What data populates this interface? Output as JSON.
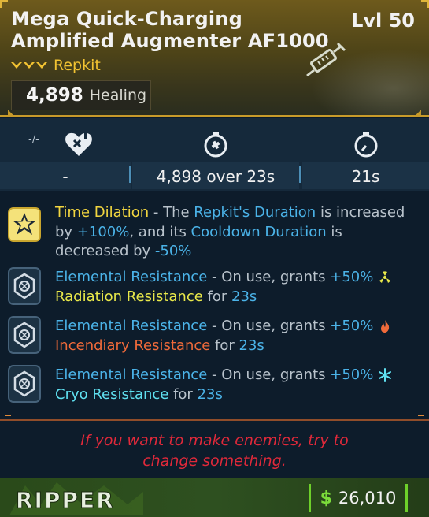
{
  "item": {
    "name": "Mega Quick-Charging Amplified Augmenter AF1000",
    "level": "Lvl 50",
    "rarity_type": "Repkit",
    "healing_value": "4,898",
    "healing_label": "Healing"
  },
  "stats": {
    "cooldown_prefix": "-/-",
    "stat1_value": "-",
    "stat2_value": "4,898 over 23s",
    "stat3_value": "21s"
  },
  "perks": [
    {
      "title": "Time Dilation",
      "sep": " - The ",
      "a": "Repkit's Duration",
      "b": " is increased by ",
      "c": "+100%",
      "d": ", and its ",
      "e": "Cooldown Duration",
      "f": " is decreased by ",
      "g": "-50%"
    },
    {
      "title": "Elemental Resistance",
      "mid": " - On use, grants ",
      "pct": "+50%",
      "element": "Radiation Resistance",
      "for": " for ",
      "dur": "23s"
    },
    {
      "title": "Elemental Resistance",
      "mid": " - On use, grants ",
      "pct": "+50%",
      "element": "Incendiary Resistance",
      "for": " for ",
      "dur": "23s"
    },
    {
      "title": "Elemental Resistance",
      "mid": " - On use, grants ",
      "pct": "+50%",
      "element": "Cryo Resistance",
      "for": " for ",
      "dur": "23s"
    }
  ],
  "flavor": {
    "line1": "If you want to make enemies, try to",
    "line2": "change something."
  },
  "footer": {
    "manufacturer": "RIPPER",
    "currency": "$",
    "price": "26,010"
  },
  "colors": {
    "rarity": "#f1c232",
    "highlight_blue": "#4bb3e8",
    "flavor_red": "#e0293a",
    "price_green": "#6ed02a"
  }
}
